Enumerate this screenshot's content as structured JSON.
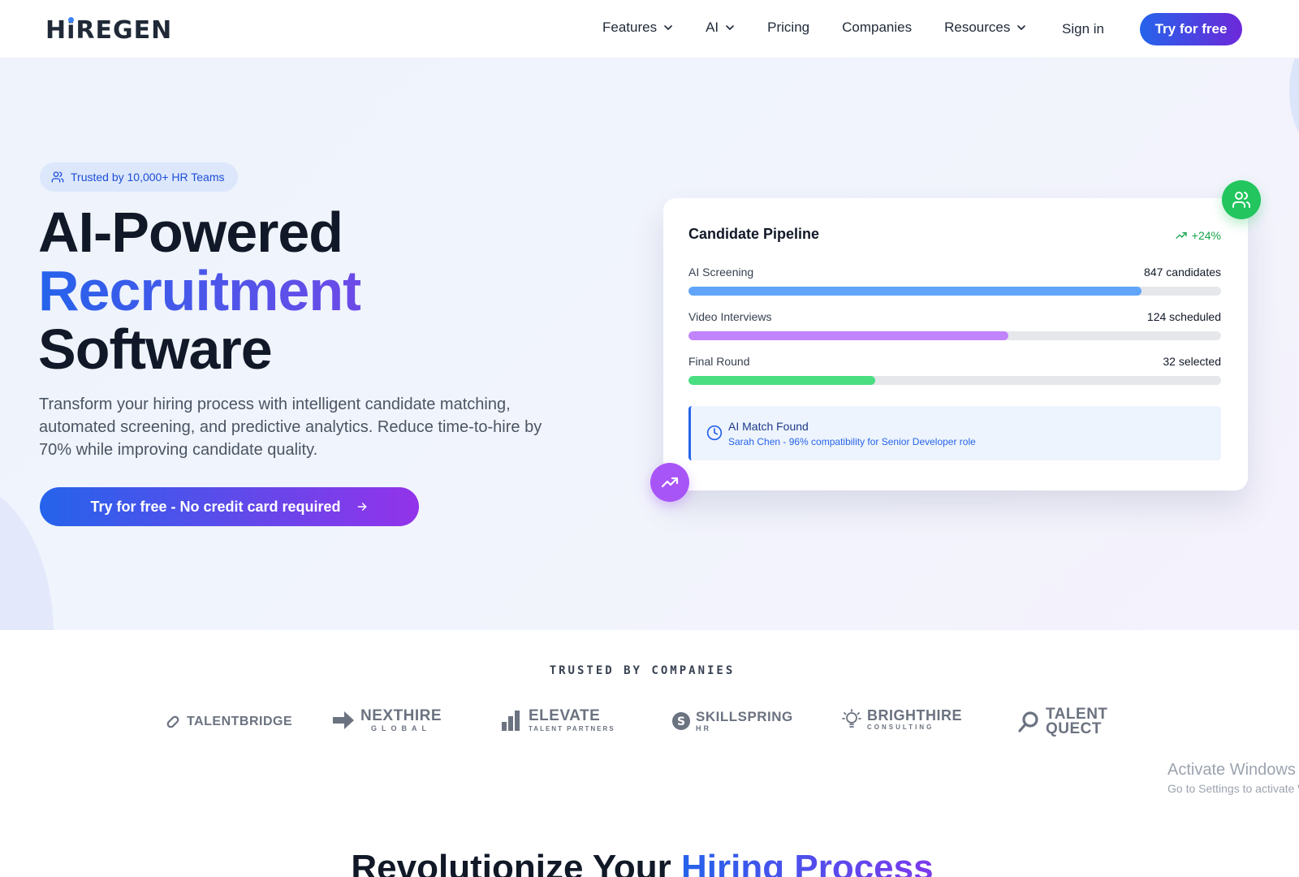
{
  "brand": {
    "name": "HiREGEN"
  },
  "nav": {
    "items": [
      {
        "label": "Features",
        "dropdown": true
      },
      {
        "label": "AI",
        "dropdown": true
      },
      {
        "label": "Pricing",
        "dropdown": false
      },
      {
        "label": "Companies",
        "dropdown": false
      },
      {
        "label": "Resources",
        "dropdown": true
      }
    ],
    "signin": "Sign in",
    "cta": "Try for free"
  },
  "hero": {
    "badge": "Trusted by 10,000+ HR Teams",
    "title_line1": "AI-Powered",
    "title_line2": "Recruitment",
    "title_line3": "Software",
    "subtitle": "Transform your hiring process with intelligent candidate matching, automated screening, and predictive analytics. Reduce time-to-hire by 70% while improving candidate quality.",
    "cta": "Try for free - No credit card required"
  },
  "pipeline": {
    "title": "Candidate Pipeline",
    "delta": "+24%",
    "rows": [
      {
        "label": "AI Screening",
        "value": "847 candidates",
        "progress": 0.85,
        "color": "#60a5fa"
      },
      {
        "label": "Video Interviews",
        "value": "124 scheduled",
        "progress": 0.6,
        "color": "#c084fc"
      },
      {
        "label": "Final Round",
        "value": "32 selected",
        "progress": 0.35,
        "color": "#4ade80"
      }
    ],
    "match_title": "AI Match Found",
    "match_text": "Sarah Chen - 96% compatibility for Senior Developer role"
  },
  "trusted": {
    "label": "TRUSTED BY COMPANIES",
    "companies": [
      {
        "name": "TALENTBRIDGE",
        "tagline": ""
      },
      {
        "name": "NEXTHIRE",
        "tagline": "GLOBAL"
      },
      {
        "name": "ELEVATE",
        "tagline": "TALENT PARTNERS"
      },
      {
        "name": "SKILLSPRING",
        "tagline": "HR"
      },
      {
        "name": "BRIGHTHIRE",
        "tagline": "CONSULTING"
      },
      {
        "name": "TALENT",
        "tagline": "QUECT"
      }
    ]
  },
  "watermark": {
    "title": "Activate Windows",
    "subtitle": "Go to Settings to activate Windows."
  },
  "section2": {
    "title_plain": "Revolutionize Your ",
    "title_accent": "Hiring Process"
  },
  "colors": {
    "primary": "#2563eb",
    "accent": "#7c3aed",
    "success": "#22c55e"
  }
}
